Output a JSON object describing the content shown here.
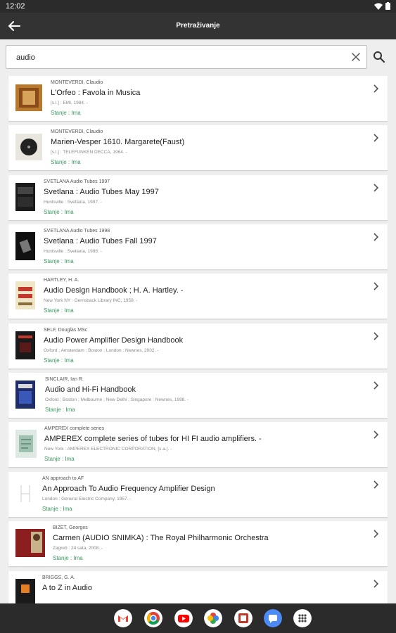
{
  "status_bar": {
    "time": "12:02"
  },
  "app_bar": {
    "title": "Pretraživanje"
  },
  "search": {
    "value": "audio"
  },
  "results": [
    {
      "author": "MONTEVERDI, Claudio",
      "title": "L'Orfeo : Favola in Musica",
      "publisher": "[s.l.] : EMI, 1984. -",
      "status": "Stanje : Ima"
    },
    {
      "author": "MONTEVERDI, Claudio",
      "title": "Marien-Vesper 1610. Margarete(Faust)",
      "publisher": "[s.l.] : TELEFUNKEN DECCA, 1964. -",
      "status": "Stanje : Ima"
    },
    {
      "author": "SVETLANA Audio Tubes 1997",
      "title": "Svetlana : Audio Tubes May 1997",
      "publisher": "Huntsville : Svetlana, 1997. -",
      "status": "Stanje : Ima"
    },
    {
      "author": "SVETLANA Audio Tubes 1998",
      "title": "Svetlana : Audio Tubes Fall 1997",
      "publisher": "Huntsville : Svetlana, 1998. -",
      "status": "Stanje : Ima"
    },
    {
      "author": "HARTLEY, H. A.",
      "title": "Audio Design Handbook ; H. A. Hartley. -",
      "publisher": "New York NY : Gernsback Library INC, 1958. -",
      "status": "Stanje : Ima"
    },
    {
      "author": "SELF, Douglas MSc",
      "title": "Audio Power Amplifier Design Handbook",
      "publisher": "Oxford ; Amsterdam ; Boston ; London : Newnes, 2002. -",
      "status": "Stanje : Ima"
    },
    {
      "author": "SINCLAIR, Ian R.",
      "title": "Audio and Hi-Fi Handbook",
      "publisher": "Oxford ; Boston ; Melbourne ; New Delhi ; Singapore : Newnes, 1998. -",
      "status": "Stanje : Ima"
    },
    {
      "author": "AMPEREX complete series",
      "title": "AMPEREX complete series of tubes for HI FI audio amplifiers. -",
      "publisher": "New York : AMPEREX ELECTRONIC CORPORATION, [s.a.]. -",
      "status": "Stanje : Ima"
    },
    {
      "author": "AN approach to AF",
      "title": "An Approach To Audio Frequency Amplifier Design",
      "publisher": "London : General Electric Company, 1957. -",
      "status": "Stanje : Ima"
    },
    {
      "author": "BIZET, Georges",
      "title": "Carmen (AUDIO SNIMKA) : The Royal Philharmonic Orchestra",
      "publisher": "Zagreb : 24 sata, 2008. -",
      "status": "Stanje : Ima"
    },
    {
      "author": "BRIGGS, G. A.",
      "title": "A to Z in Audio",
      "publisher": "",
      "status": ""
    }
  ],
  "colors": {
    "status_green": "#3a9a5f",
    "toolbar": "#333333",
    "background": "#eeeeee"
  },
  "dock_apps": [
    {
      "name": "gmail-icon",
      "color": "#ffffff"
    },
    {
      "name": "chrome-icon",
      "color": "#ffffff"
    },
    {
      "name": "youtube-icon",
      "color": "#ffffff"
    },
    {
      "name": "photos-icon",
      "color": "#ffffff"
    },
    {
      "name": "library-app-icon",
      "color": "#ffffff"
    },
    {
      "name": "messages-icon",
      "color": "#4c8bf5"
    },
    {
      "name": "app-drawer-icon",
      "color": "#ffffff"
    }
  ]
}
